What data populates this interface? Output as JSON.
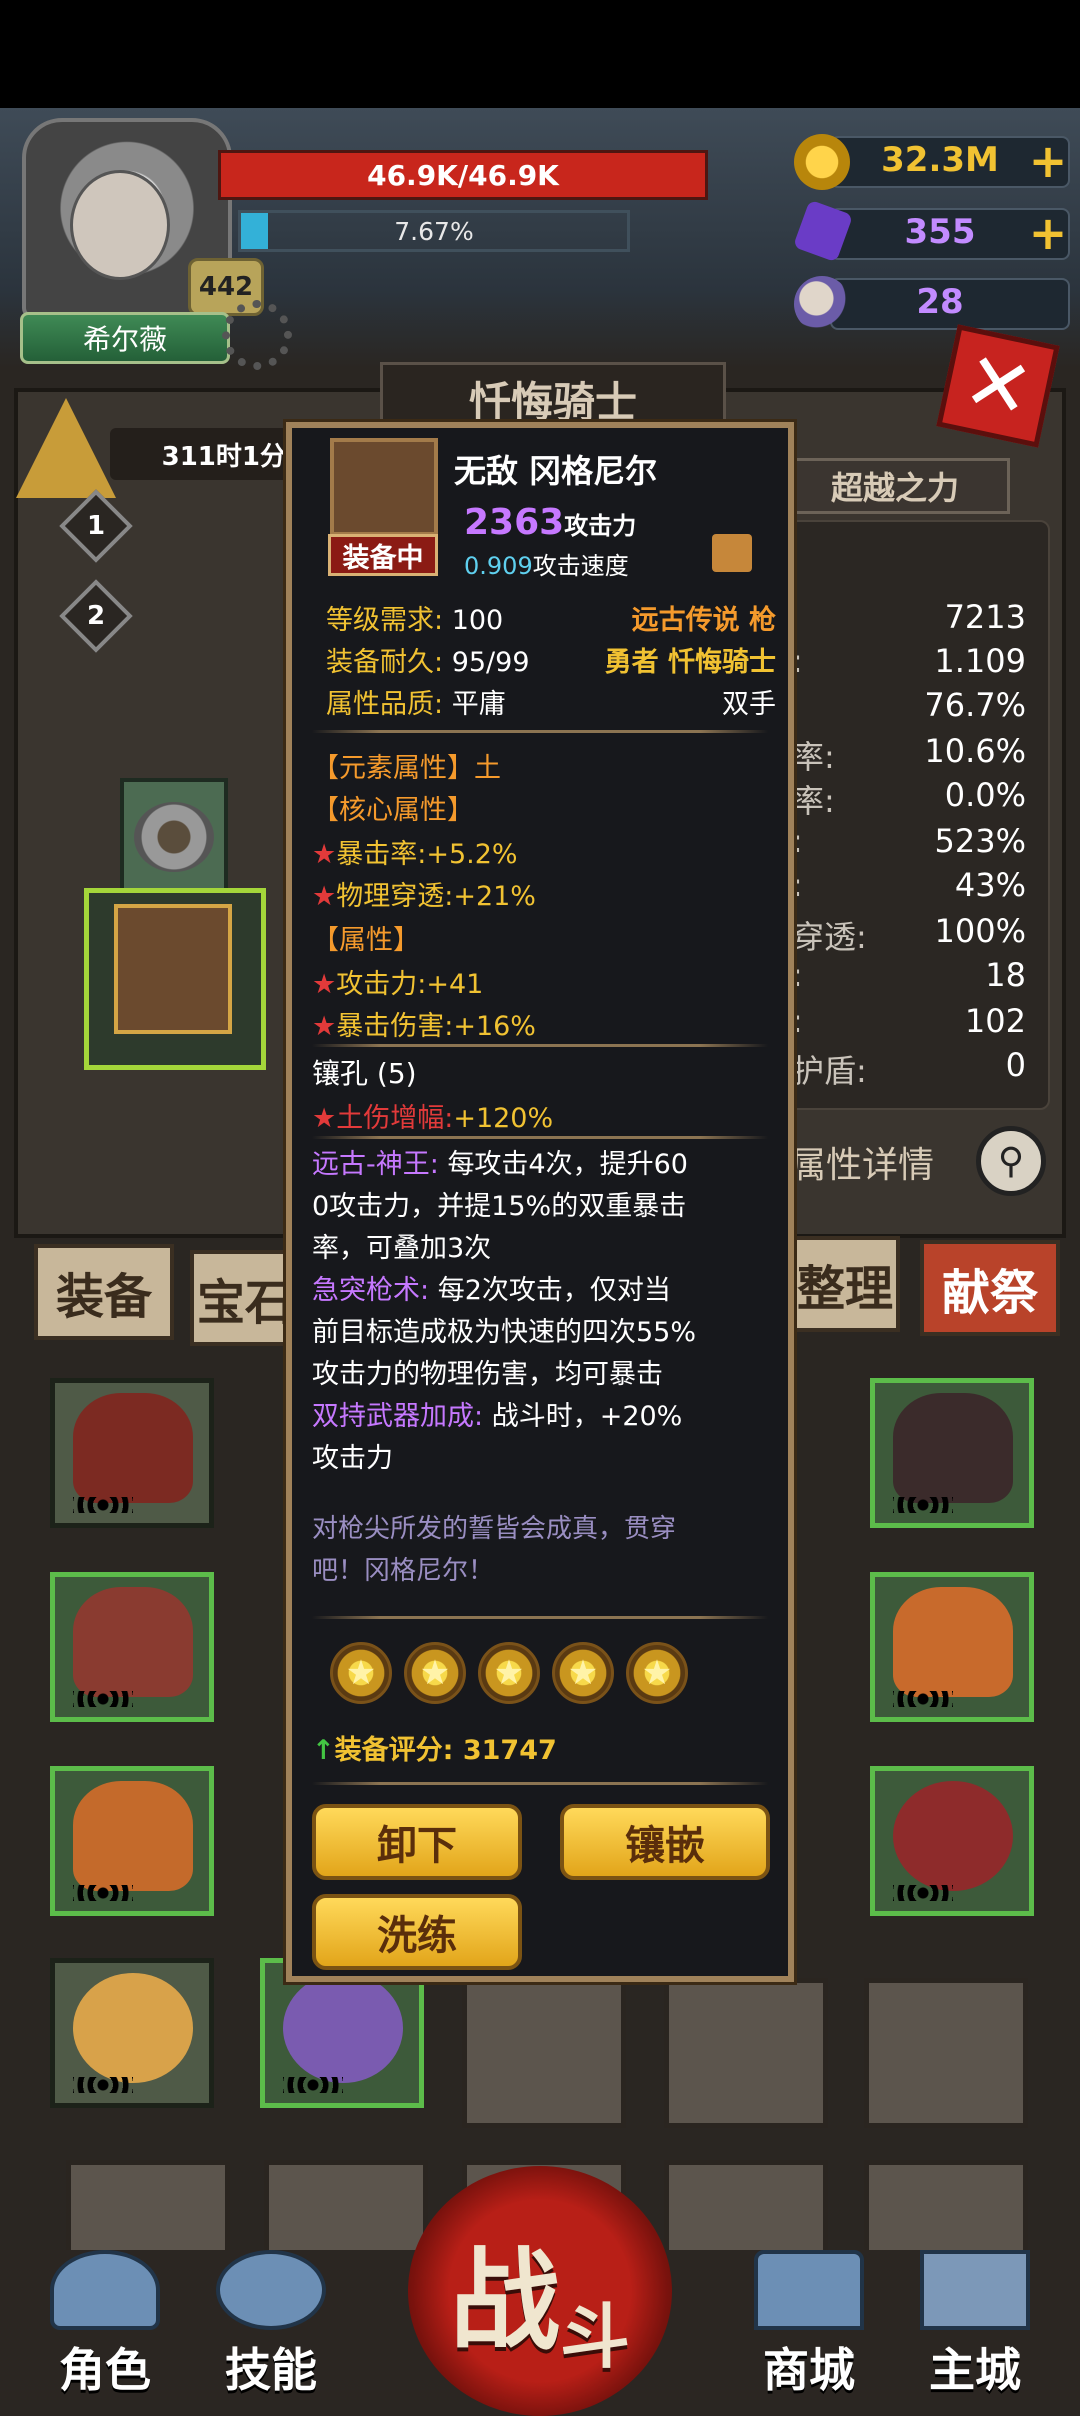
{
  "player": {
    "name": "希尔薇",
    "level": "442",
    "hp": "46.9K/46.9K",
    "xp_percent": "7.67%"
  },
  "resources": {
    "gold": "32.3M",
    "gems": "355",
    "horns": "28"
  },
  "panel": {
    "title": "忏悔骑士",
    "timer": "311时1分",
    "tiers": [
      "1",
      "2"
    ],
    "beyond_label": "超越之力",
    "stats": [
      {
        "label": "",
        "value": "7213"
      },
      {
        "label": ":",
        "value": "1.109"
      },
      {
        "label": "",
        "value": "76.7%"
      },
      {
        "label": "率:",
        "value": "10.6%"
      },
      {
        "label": "率:",
        "value": "0.0%"
      },
      {
        "label": ":",
        "value": "523%"
      },
      {
        "label": ":",
        "value": "43%"
      },
      {
        "label": "穿透:",
        "value": "100%"
      },
      {
        "label": ":",
        "value": "18"
      },
      {
        "label": ":",
        "value": "102"
      },
      {
        "label": "护盾:",
        "value": "0"
      }
    ],
    "detail_label": "属性详情"
  },
  "tabs": {
    "equip": "装备",
    "treasure": "宝石",
    "sort": "整理",
    "sacrifice": "献祭"
  },
  "popup": {
    "name": "无敌 冈格尼尔",
    "status": "装备中",
    "attack_value": "2363",
    "attack_label": "攻击力",
    "speed_value": "0.909",
    "speed_label": "攻击速度",
    "level_req_label": "等级需求:",
    "level_req": "100",
    "rarity": "远古传说 枪",
    "durability_label": "装备耐久:",
    "durability": "95/99",
    "class": "勇者 忏悔骑士",
    "quality_label": "属性品质:",
    "quality": "平庸",
    "hand": "双手",
    "element": "【元素属性】土",
    "core_header": "【核心属性】",
    "core": [
      {
        "label": "暴击率:",
        "value": "+5.2%"
      },
      {
        "label": "物理穿透:",
        "value": "+21%"
      }
    ],
    "attr_header": "【属性】",
    "attrs": [
      {
        "label": "攻击力:",
        "value": "+41"
      },
      {
        "label": "暴击伤害:",
        "value": "+16%"
      }
    ],
    "socket_header": "镶孔 (5)",
    "socket": {
      "label": "土伤增幅:",
      "value": "+120%"
    },
    "skills": [
      {
        "name": "远古-神王:",
        "line1": "每攻击4次，提升60",
        "line2": "0攻击力，并提15%的双重暴击",
        "line3": "率，可叠加3次"
      },
      {
        "name": "急突枪术:",
        "line1": "每2次攻击，仅对当",
        "line2": "前目标造成极为快速的四次55%",
        "line3": "攻击力的物理伤害，均可暴击"
      },
      {
        "name": "双持武器加成:",
        "line1": "战斗时，+20%",
        "line2": "攻击力",
        "line3": ""
      }
    ],
    "lore_line1": "对枪尖所发的誓皆会成真，贯穿",
    "lore_line2": "吧！冈格尼尔！",
    "stars": [
      "★",
      "★",
      "★",
      "★",
      "★"
    ],
    "score_label": "装备评分:",
    "score": "31747",
    "buttons": {
      "unequip": "卸下",
      "inlay": "镶嵌",
      "reforge": "洗练"
    }
  },
  "nav": {
    "character": "角色",
    "skills": "技能",
    "battle_a": "战",
    "battle_b": "斗",
    "shop": "商城",
    "main": "主城"
  },
  "icons": {
    "close": "✕",
    "plus": "+",
    "search": "⚲",
    "arrow": "↑"
  },
  "colors": {
    "hp_bar": "#c8261c",
    "xp_fill": "#33b1d8",
    "gold_text": "#f1c232",
    "popup_border": "#a0825a",
    "button_gold": "#e2a51a"
  }
}
